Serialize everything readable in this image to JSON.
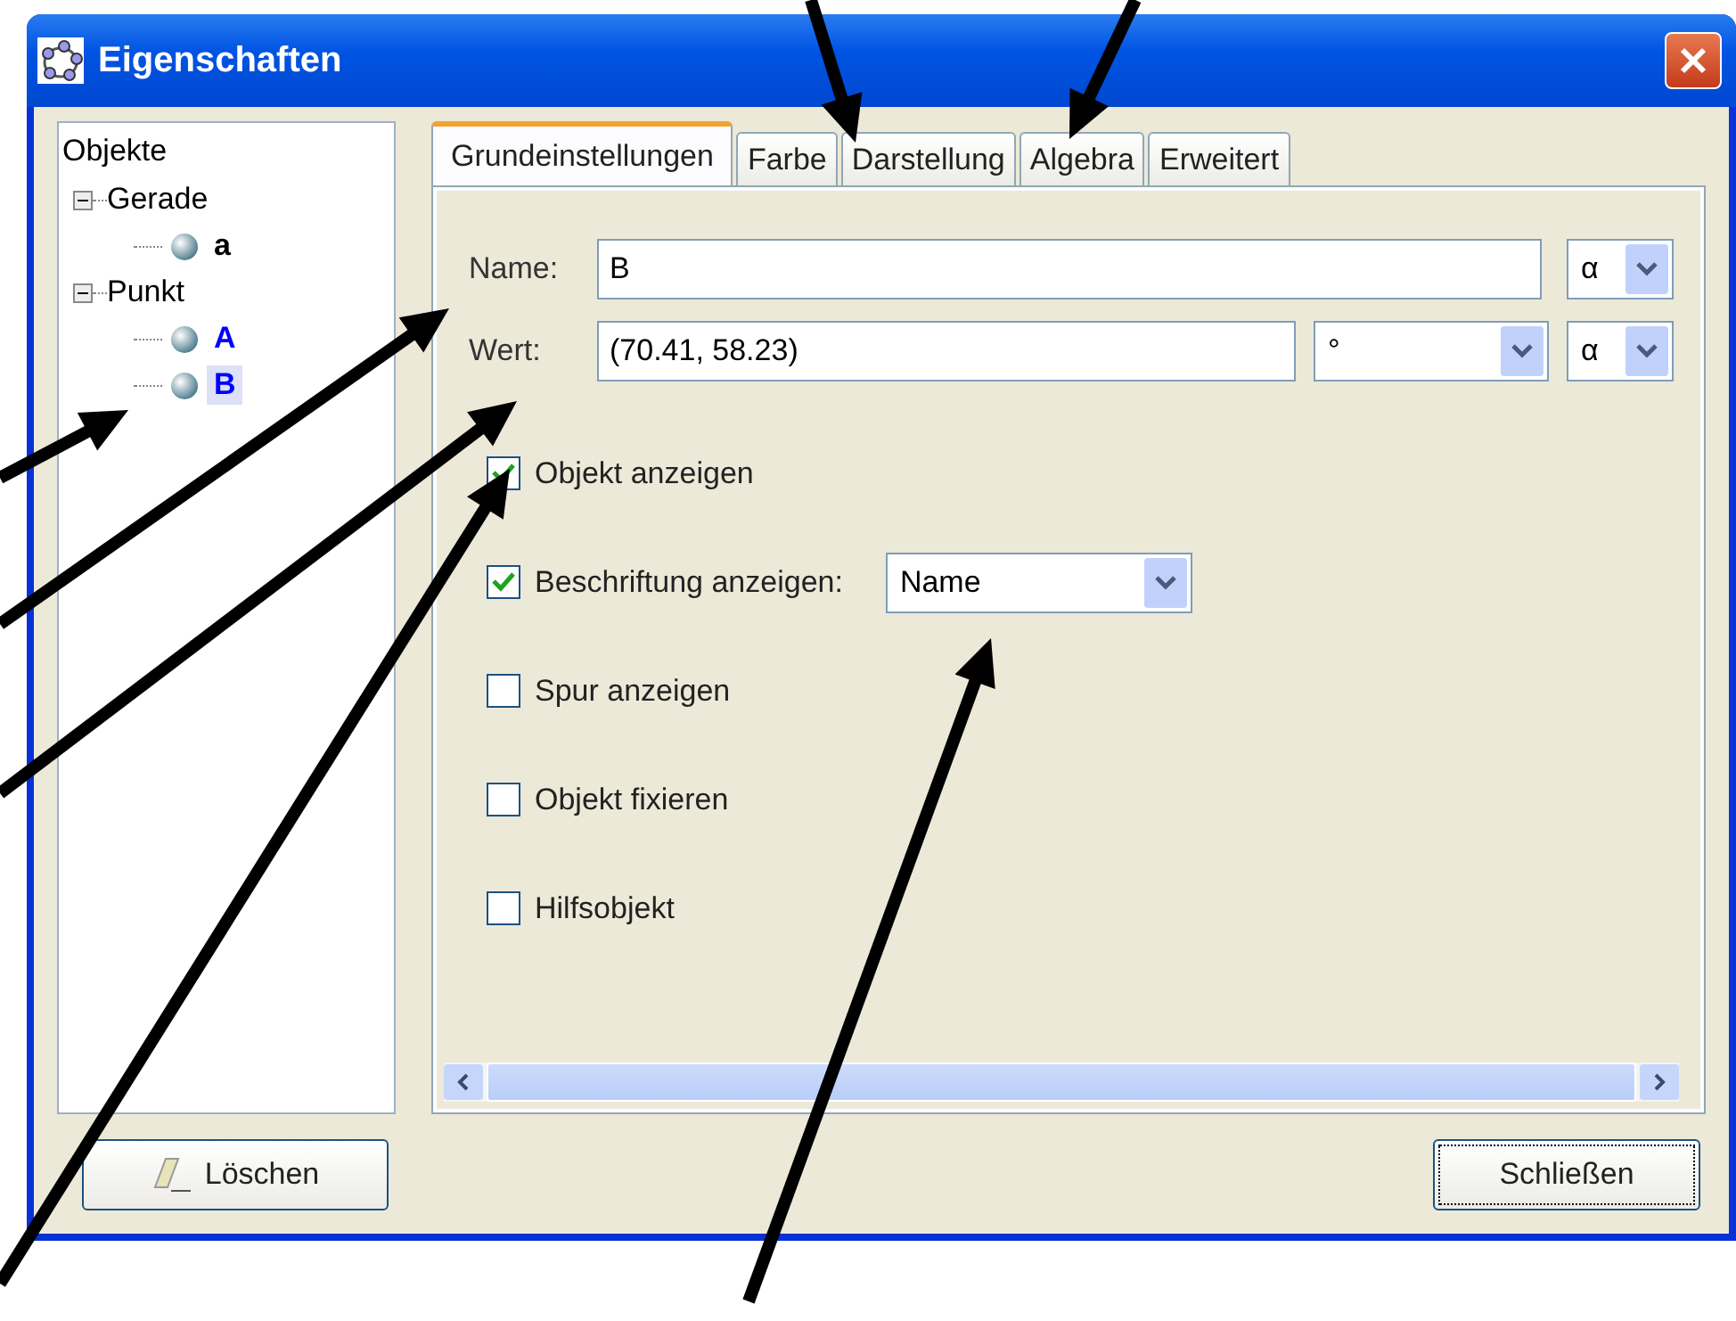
{
  "window": {
    "title": "Eigenschaften"
  },
  "tree": {
    "label": "Objekte",
    "children": [
      {
        "label": "Gerade",
        "expanded": true,
        "children": [
          {
            "label": "a",
            "color": "#000000",
            "selected": false
          }
        ]
      },
      {
        "label": "Punkt",
        "expanded": true,
        "children": [
          {
            "label": "A",
            "color": "#0000ff",
            "selected": false
          },
          {
            "label": "B",
            "color": "#0000ff",
            "selected": true
          }
        ]
      }
    ]
  },
  "tabs": [
    {
      "label": "Grundeinstellungen",
      "selected": true
    },
    {
      "label": "Farbe",
      "selected": false
    },
    {
      "label": "Darstellung",
      "selected": false
    },
    {
      "label": "Algebra",
      "selected": false
    },
    {
      "label": "Erweitert",
      "selected": false
    }
  ],
  "name_row": {
    "label": "Name:",
    "value": "B",
    "symbol": "α"
  },
  "value_row": {
    "label": "Wert:",
    "value": "(70.41, 58.23)",
    "unit": "°",
    "symbol": "α"
  },
  "options": [
    {
      "label": "Objekt anzeigen",
      "checked": true
    },
    {
      "label": "Beschriftung anzeigen:",
      "checked": true,
      "dropdown": "Name"
    },
    {
      "label": "Spur anzeigen",
      "checked": false
    },
    {
      "label": "Objekt fixieren",
      "checked": false
    },
    {
      "label": "Hilfsobjekt",
      "checked": false
    }
  ],
  "buttons": {
    "delete": "Löschen",
    "close": "Schließen"
  }
}
